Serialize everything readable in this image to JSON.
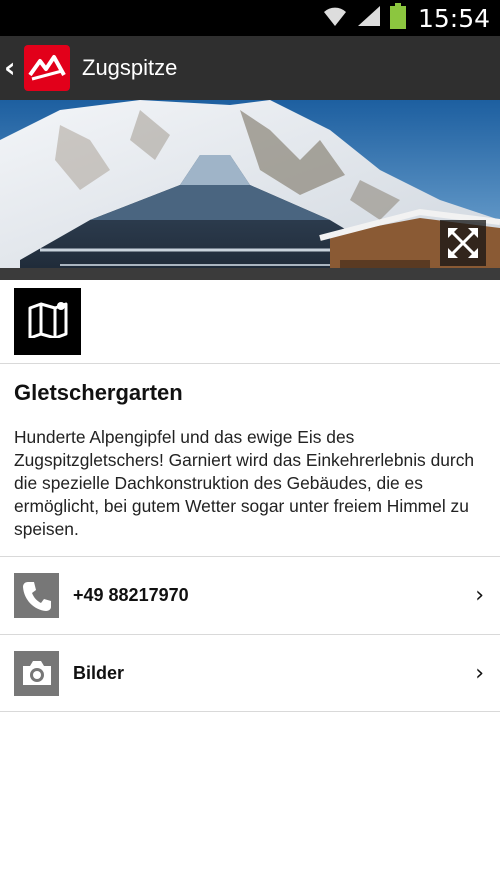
{
  "status_bar": {
    "time": "15:54"
  },
  "action_bar": {
    "back_icon": "‹",
    "title": "Zugspitze"
  },
  "entry": {
    "title": "Gletschergarten",
    "description": "Hunderte Alpengipfel und das ewige Eis des Zugspitzgletschers! Garniert wird das Einkehrerlebnis durch die spezielle Dachkonstruktion des Gebäudes, die es ermöglicht, bei gutem Wetter sogar unter freiem Himmel zu speisen."
  },
  "contacts": {
    "phone": "+49 88217970",
    "images": "Bilder",
    "chevron": "›"
  },
  "icons": {
    "map": "map-icon",
    "phone": "phone-icon",
    "camera": "camera-icon",
    "expand": "expand-icon"
  },
  "colors": {
    "brand": "#e2001a",
    "action_bar": "#2f2f2f",
    "battery": "#8cc63f"
  }
}
